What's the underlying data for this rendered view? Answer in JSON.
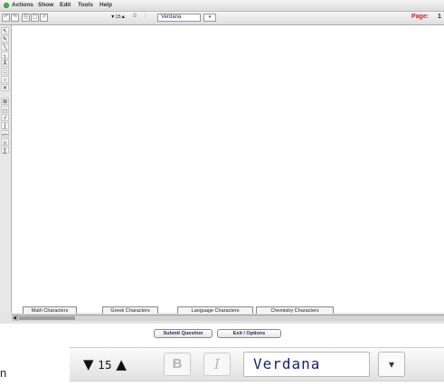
{
  "menu": [
    "Actions",
    "Show",
    "Edit",
    "Tools",
    "Help"
  ],
  "toolbar": {
    "icons": [
      "undo-icon",
      "redo-icon",
      "copy-icon",
      "paste-icon",
      "pointer-icon"
    ],
    "font_size": "▼15▲",
    "bold_label": "B",
    "italic_label": "I",
    "font_name": "Verdana",
    "font_dropdown": "▾",
    "page_label": "Page:",
    "page_number": "1"
  },
  "palette": {
    "tools": [
      {
        "name": "pointer-tool-icon",
        "glyph": "↖"
      },
      {
        "name": "pencil-tool-icon",
        "glyph": "✎"
      },
      {
        "name": "line-tool-icon",
        "glyph": "╲"
      },
      {
        "name": "curve-tool-icon",
        "glyph": "╮"
      },
      {
        "name": "text-tool-icon",
        "glyph": "Ǎ"
      },
      {
        "name": "rectangle-tool-icon",
        "glyph": "□"
      },
      {
        "name": "ellipse-tool-icon",
        "glyph": "○"
      },
      {
        "name": "eraser-tool-icon",
        "glyph": "✕"
      },
      {
        "name": "grid-tool-icon",
        "glyph": "⊞"
      },
      {
        "name": "bracket-tool-icon",
        "glyph": "(?)"
      },
      {
        "name": "sqrt-tool-icon",
        "glyph": "√"
      },
      {
        "name": "integral-tool-icon",
        "glyph": "∫"
      },
      {
        "name": "power-tool-icon",
        "glyph": "a^b"
      },
      {
        "name": "matrix-tool-icon",
        "glyph": "[:]"
      },
      {
        "name": "sigma-tool-icon",
        "glyph": "∑"
      }
    ]
  },
  "tabs": [
    "Math Characters",
    "Greek Characters",
    "Language Characters",
    "Chemistry Characters"
  ],
  "buttons": {
    "submit": "Submit Question",
    "exit": "Exit / Options"
  },
  "zoom": {
    "edge_text": "n",
    "font_size_down": "▼",
    "font_size_value": "15",
    "font_size_up": "▲",
    "bold_label": "B",
    "italic_label": "I",
    "font_name": "Verdana",
    "font_dropdown": "▾"
  },
  "colors": {
    "page_label": "#d01c1c",
    "status_dot": "#3fbf3f",
    "font_text": "#1a1a80"
  }
}
